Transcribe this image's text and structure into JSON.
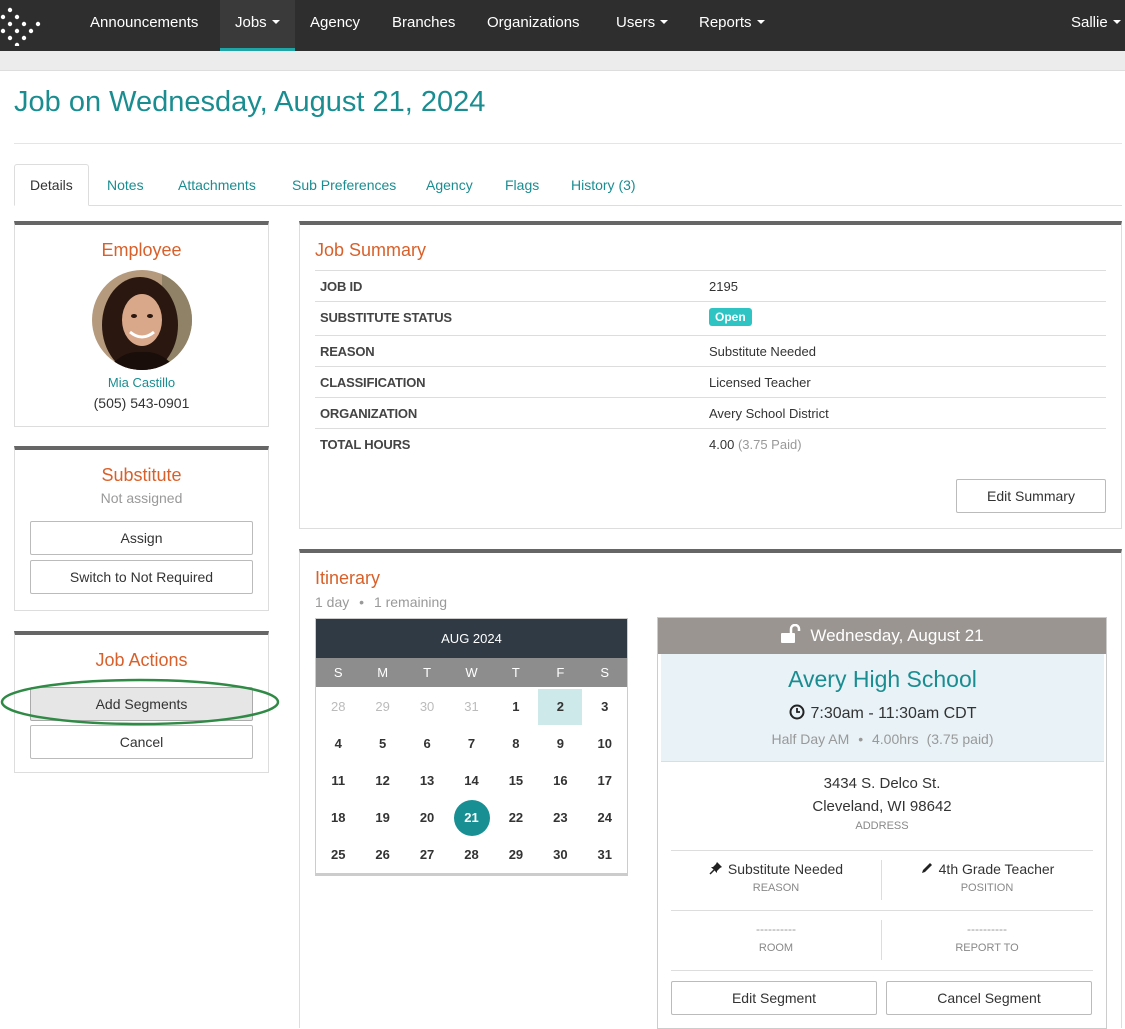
{
  "nav": {
    "items": [
      {
        "label": "Announcements",
        "dropdown": false,
        "active": false
      },
      {
        "label": "Jobs",
        "dropdown": true,
        "active": true
      },
      {
        "label": "Agency",
        "dropdown": false,
        "active": false
      },
      {
        "label": "Branches",
        "dropdown": false,
        "active": false
      },
      {
        "label": "Organizations",
        "dropdown": false,
        "active": false
      },
      {
        "label": "Users",
        "dropdown": true,
        "active": false
      },
      {
        "label": "Reports",
        "dropdown": true,
        "active": false
      }
    ],
    "user": "Sallie"
  },
  "page": {
    "title": "Job on Wednesday, August 21, 2024"
  },
  "tabs": [
    {
      "label": "Details",
      "active": true
    },
    {
      "label": "Notes",
      "active": false
    },
    {
      "label": "Attachments",
      "active": false
    },
    {
      "label": "Sub Preferences",
      "active": false
    },
    {
      "label": "Agency",
      "active": false
    },
    {
      "label": "Flags",
      "active": false
    },
    {
      "label": "History (3)",
      "active": false
    }
  ],
  "employee": {
    "title": "Employee",
    "name": "Mia Castillo",
    "phone": "(505) 543-0901"
  },
  "substitute": {
    "title": "Substitute",
    "status": "Not assigned",
    "assign_label": "Assign",
    "switch_label": "Switch to Not Required"
  },
  "job_actions": {
    "title": "Job Actions",
    "add_segments_label": "Add Segments",
    "cancel_label": "Cancel"
  },
  "summary": {
    "title": "Job Summary",
    "job_id_label": "JOB ID",
    "job_id": "2195",
    "sub_status_label": "SUBSTITUTE STATUS",
    "sub_status": "Open",
    "reason_label": "REASON",
    "reason": "Substitute Needed",
    "classification_label": "CLASSIFICATION",
    "classification": "Licensed Teacher",
    "organization_label": "ORGANIZATION",
    "organization": "Avery School District",
    "total_hours_label": "TOTAL HOURS",
    "total_hours": "4.00",
    "paid_hours": "(3.75 Paid)",
    "edit_label": "Edit Summary"
  },
  "itinerary": {
    "title": "Itinerary",
    "days": "1 day",
    "remaining": "1 remaining"
  },
  "calendar": {
    "month": "AUG 2024",
    "dow": [
      "S",
      "M",
      "T",
      "W",
      "T",
      "F",
      "S"
    ],
    "weeks": [
      [
        "28",
        "29",
        "30",
        "31",
        "1",
        "2",
        "3"
      ],
      [
        "4",
        "5",
        "6",
        "7",
        "8",
        "9",
        "10"
      ],
      [
        "11",
        "12",
        "13",
        "14",
        "15",
        "16",
        "17"
      ],
      [
        "18",
        "19",
        "20",
        "21",
        "22",
        "23",
        "24"
      ],
      [
        "25",
        "26",
        "27",
        "28",
        "29",
        "30",
        "31"
      ]
    ],
    "other_month_count": 4,
    "highlighted": "2",
    "selected": "21"
  },
  "segment": {
    "date": "Wednesday, August 21",
    "school": "Avery High School",
    "time": "7:30am - 11:30am CDT",
    "day_type": "Half Day AM",
    "hours": "4.00hrs",
    "paid": "(3.75 paid)",
    "address_line1": "3434 S. Delco St.",
    "address_line2": "Cleveland, WI 98642",
    "address_label": "ADDRESS",
    "reason": "Substitute Needed",
    "reason_label": "REASON",
    "position": "4th Grade Teacher",
    "position_label": "POSITION",
    "room": "----------",
    "room_label": "ROOM",
    "report_to": "----------",
    "report_to_label": "REPORT TO",
    "edit_label": "Edit Segment",
    "cancel_label": "Cancel Segment"
  },
  "colors": {
    "accent": "#1a8d91",
    "heading": "#d9602a",
    "navbar": "#2e2e2e",
    "badge": "#2ec4c4",
    "highlight_oval": "#2f8a45"
  }
}
